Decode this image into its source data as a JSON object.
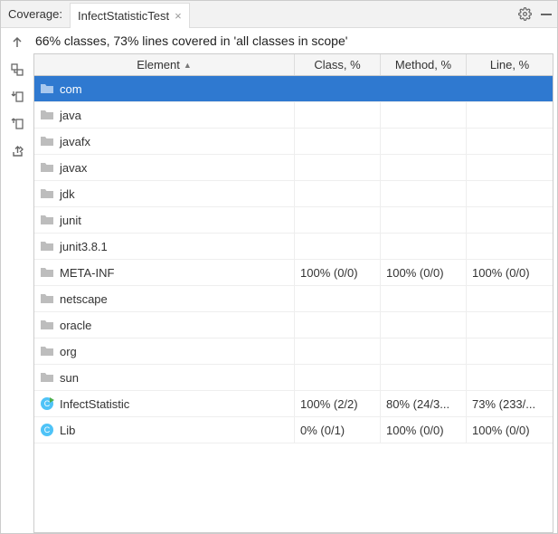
{
  "header": {
    "coverage_label": "Coverage:",
    "tab_title": "InfectStatisticTest"
  },
  "summary": "66% classes, 73% lines covered in 'all classes in scope'",
  "columns": {
    "element": "Element",
    "class": "Class, %",
    "method": "Method, %",
    "line": "Line, %"
  },
  "rows": [
    {
      "name": "com",
      "icon": "folder",
      "class": "",
      "method": "",
      "line": "",
      "selected": true
    },
    {
      "name": "java",
      "icon": "folder",
      "class": "",
      "method": "",
      "line": ""
    },
    {
      "name": "javafx",
      "icon": "folder",
      "class": "",
      "method": "",
      "line": ""
    },
    {
      "name": "javax",
      "icon": "folder",
      "class": "",
      "method": "",
      "line": ""
    },
    {
      "name": "jdk",
      "icon": "folder",
      "class": "",
      "method": "",
      "line": ""
    },
    {
      "name": "junit",
      "icon": "folder",
      "class": "",
      "method": "",
      "line": ""
    },
    {
      "name": "junit3.8.1",
      "icon": "folder",
      "class": "",
      "method": "",
      "line": ""
    },
    {
      "name": "META-INF",
      "icon": "folder",
      "class": "100% (0/0)",
      "method": "100% (0/0)",
      "line": "100% (0/0)"
    },
    {
      "name": "netscape",
      "icon": "folder",
      "class": "",
      "method": "",
      "line": ""
    },
    {
      "name": "oracle",
      "icon": "folder",
      "class": "",
      "method": "",
      "line": ""
    },
    {
      "name": "org",
      "icon": "folder",
      "class": "",
      "method": "",
      "line": ""
    },
    {
      "name": "sun",
      "icon": "folder",
      "class": "",
      "method": "",
      "line": ""
    },
    {
      "name": "InfectStatistic",
      "icon": "class-run",
      "class": "100% (2/2)",
      "method": "80% (24/3...",
      "line": "73% (233/..."
    },
    {
      "name": "Lib",
      "icon": "class",
      "class": "0% (0/1)",
      "method": "100% (0/0)",
      "line": "100% (0/0)"
    }
  ]
}
